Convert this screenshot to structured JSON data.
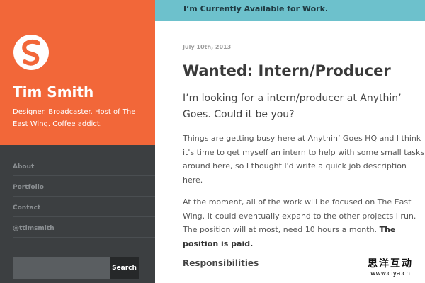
{
  "sidebar": {
    "logo_icon": "s-swirl-logo-icon",
    "site_name": "Tim Smith",
    "tagline": "Designer. Broadcaster. Host of The East Wing. Coffee addict.",
    "nav": [
      {
        "label": "About"
      },
      {
        "label": "Portfolio"
      },
      {
        "label": "Contact"
      },
      {
        "label": "@ttimsmith"
      }
    ],
    "search": {
      "placeholder": "",
      "button_label": "Search"
    },
    "colors": {
      "profile_bg": "#f26739",
      "nav_bg": "#3c3f41"
    }
  },
  "banner": {
    "text": "I’m Currently Available for Work.",
    "color": "#6dc1cc"
  },
  "post": {
    "date": "July 10th, 2013",
    "title": "Wanted: Intern/Producer",
    "lead": "I’m looking for a intern/producer at Anythin’ Goes. Could it be you?",
    "para1": "Things are getting busy here at Anythin’ Goes HQ and I think it's time to get myself an intern to help with some small tasks around here, so I thought I'd write a quick job description here.",
    "para2": "At the moment, all of the work will be focused on The East Wing. It could eventually expand to the other projects I run. The position will at most, need 10 hours a month.",
    "para2_bold": "The position is paid.",
    "section_heading": "Responsibilities"
  },
  "watermark": {
    "text": "思洋互动",
    "url": "www.ciya.cn"
  }
}
